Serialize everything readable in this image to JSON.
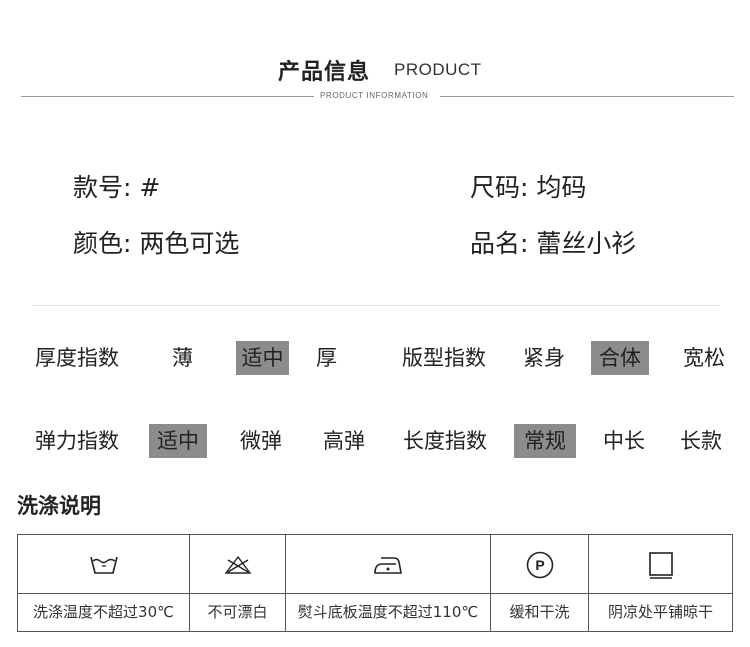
{
  "header": {
    "title_cn": "产品信息",
    "title_en": "PRODUCT",
    "subtitle_en": "PRODUCT INFORMATION"
  },
  "info": {
    "style_no": "款号: #",
    "size": "尺码: 均码",
    "color": "颜色: 两色可选",
    "name": "品名: 蕾丝小衫"
  },
  "indices": {
    "thickness": {
      "label": "厚度指数",
      "options": [
        "薄",
        "适中",
        "厚"
      ],
      "selected": "适中"
    },
    "fit": {
      "label": "版型指数",
      "options": [
        "紧身",
        "合体",
        "宽松"
      ],
      "selected": "合体"
    },
    "elasticity": {
      "label": "弹力指数",
      "options": [
        "适中",
        "微弹",
        "高弹"
      ],
      "selected": "适中"
    },
    "length": {
      "label": "长度指数",
      "options": [
        "常规",
        "中长",
        "长款"
      ],
      "selected": "常规"
    }
  },
  "washing": {
    "title": "洗涤说明",
    "items": [
      {
        "icon": "wash-30-icon",
        "label": "洗涤温度不超过30℃"
      },
      {
        "icon": "no-bleach-icon",
        "label": "不可漂白"
      },
      {
        "icon": "iron-icon",
        "label": "熨斗底板温度不超过110℃"
      },
      {
        "icon": "dry-clean-p-icon",
        "label": "缓和干洗",
        "icon_text": "P"
      },
      {
        "icon": "dry-flat-shade-icon",
        "label": "阴凉处平铺晾干"
      }
    ]
  },
  "colors": {
    "chip": "#8c8c8c",
    "text": "#222222",
    "border": "#555555"
  }
}
